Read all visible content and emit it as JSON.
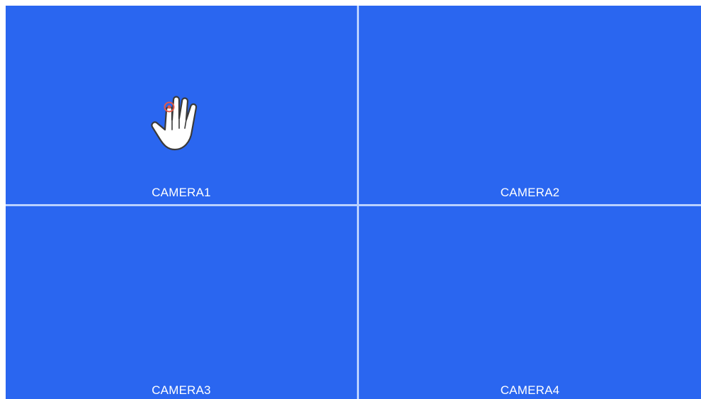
{
  "grid": {
    "background_color": "#2a66f0",
    "divider_color": "#b9d0ff",
    "cameras": [
      {
        "label": "CAMERA1"
      },
      {
        "label": "CAMERA2"
      },
      {
        "label": "CAMERA3"
      },
      {
        "label": "CAMERA4"
      }
    ]
  },
  "cursor": {
    "icon": "hand-pointer-icon"
  }
}
